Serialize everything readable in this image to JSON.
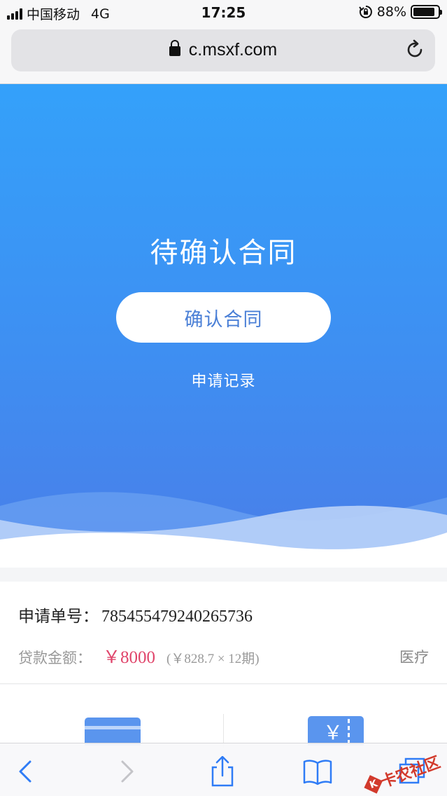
{
  "status_bar": {
    "carrier": "中国移动",
    "network": "4G",
    "time": "17:25",
    "battery": "88%",
    "battery_level": 0.88
  },
  "browser": {
    "url": "c.msxf.com"
  },
  "hero": {
    "title": "待确认合同",
    "confirm_button": "确认合同",
    "records_link": "申请记录"
  },
  "application": {
    "number_label": "申请单号：",
    "number": "785455479240265736",
    "amount_label": "贷款金额：",
    "amount": "￥8000",
    "installment": "(￥828.7 × 12期)",
    "category": "医疗"
  },
  "services": {
    "ticket_symbol": "￥"
  },
  "watermark": {
    "text": "卡农社区",
    "mark": "K"
  },
  "colors": {
    "hero_top": "#34a1fa",
    "hero_bottom": "#4a7ee8",
    "accent_blue": "#4a7fd6",
    "amount_red": "#e0456b",
    "icon_blue": "#5a95ee"
  }
}
